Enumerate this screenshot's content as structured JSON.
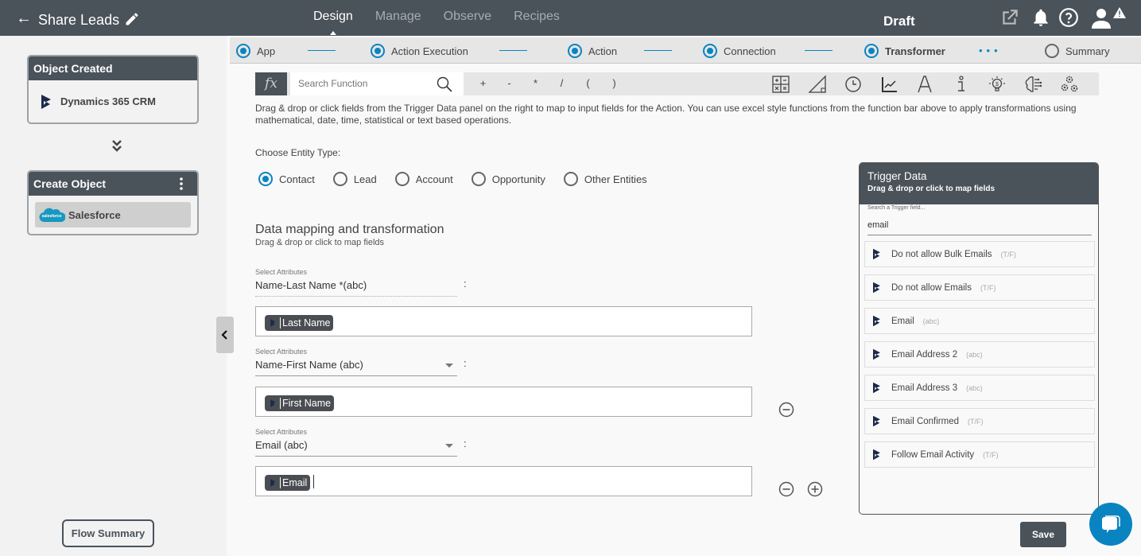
{
  "header": {
    "back_icon": "arrow-left-icon",
    "title": "Share Leads",
    "edit_icon": "pencil-icon",
    "nav": [
      {
        "label": "Design",
        "active": true
      },
      {
        "label": "Manage",
        "active": false
      },
      {
        "label": "Observe",
        "active": false
      },
      {
        "label": "Recipes",
        "active": false
      }
    ],
    "status": "Draft",
    "icons": [
      "external-link-icon",
      "bell-icon",
      "help-icon",
      "user-warning-icon"
    ]
  },
  "sidebar": {
    "trigger_card": {
      "title": "Object Created",
      "app": "Dynamics 365 CRM",
      "app_icon": "dynamics-logo-icon"
    },
    "flow_arrow_icon": "chevron-double-down-icon",
    "action_card": {
      "title": "Create Object",
      "app": "Salesforce",
      "app_icon": "salesforce-logo-icon",
      "menu_icon": "kebab-menu-icon"
    },
    "flow_summary_button": "Flow Summary",
    "collapse_icon": "chevron-left-icon"
  },
  "stepper": {
    "steps": [
      {
        "label": "App",
        "state": "done"
      },
      {
        "label": "Action Execution",
        "state": "done"
      },
      {
        "label": "Action",
        "state": "done"
      },
      {
        "label": "Connection",
        "state": "done"
      },
      {
        "label": "Transformer",
        "state": "current"
      },
      {
        "label": "Summary",
        "state": "pending"
      }
    ]
  },
  "function_bar": {
    "fx_label": "fx",
    "search_placeholder": "Search Function",
    "operators": [
      "+",
      "-",
      "*",
      "/",
      "(",
      ")"
    ],
    "tool_icons": [
      "calculator-icon",
      "trigonometry-icon",
      "clock-icon",
      "line-chart-icon",
      "text-icon",
      "info-icon",
      "finance-bulb-icon",
      "ai-brain-icon",
      "gears-icon"
    ]
  },
  "description": "Drag & drop or click fields from the Trigger Data panel on the right to map to input fields for the Action. You can use excel style functions from the function bar above to apply transformations using mathematical, date, time, statistical or text based operations.",
  "entity": {
    "label": "Choose Entity Type:",
    "options": [
      {
        "label": "Contact",
        "selected": true
      },
      {
        "label": "Lead",
        "selected": false
      },
      {
        "label": "Account",
        "selected": false
      },
      {
        "label": "Opportunity",
        "selected": false
      },
      {
        "label": "Other Entities",
        "selected": false
      }
    ]
  },
  "mapping": {
    "title": "Data mapping and transformation",
    "subtitle": "Drag & drop or click to map fields",
    "select_label": "Select Attributes",
    "separator": ":",
    "rows": [
      {
        "attribute": "Name-Last Name *(abc)",
        "mapped_field": "Last Name",
        "dropdown": false
      },
      {
        "attribute": "Name-First Name (abc)",
        "mapped_field": "First Name",
        "dropdown": true
      },
      {
        "attribute": "Email (abc)",
        "mapped_field": "Email",
        "dropdown": true
      }
    ]
  },
  "trigger_data": {
    "title": "Trigger Data",
    "subtitle": "Drag & drop or click to map fields",
    "search_label": "Search a Trigger field...",
    "search_value": "email",
    "fields": [
      {
        "name": "Do not allow Bulk Emails",
        "type": "(T/F)"
      },
      {
        "name": "Do not allow Emails",
        "type": "(T/F)"
      },
      {
        "name": "Email",
        "type": "(abc)"
      },
      {
        "name": "Email Address 2",
        "type": "(abc)"
      },
      {
        "name": "Email Address 3",
        "type": "(abc)"
      },
      {
        "name": "Email Confirmed",
        "type": "(T/F)"
      },
      {
        "name": "Follow Email Activity",
        "type": "(T/F)"
      }
    ]
  },
  "save_button": "Save",
  "chat_icon": "chat-bubble-icon",
  "colors": {
    "header": "#4a525a",
    "accent": "#0a84c1"
  }
}
